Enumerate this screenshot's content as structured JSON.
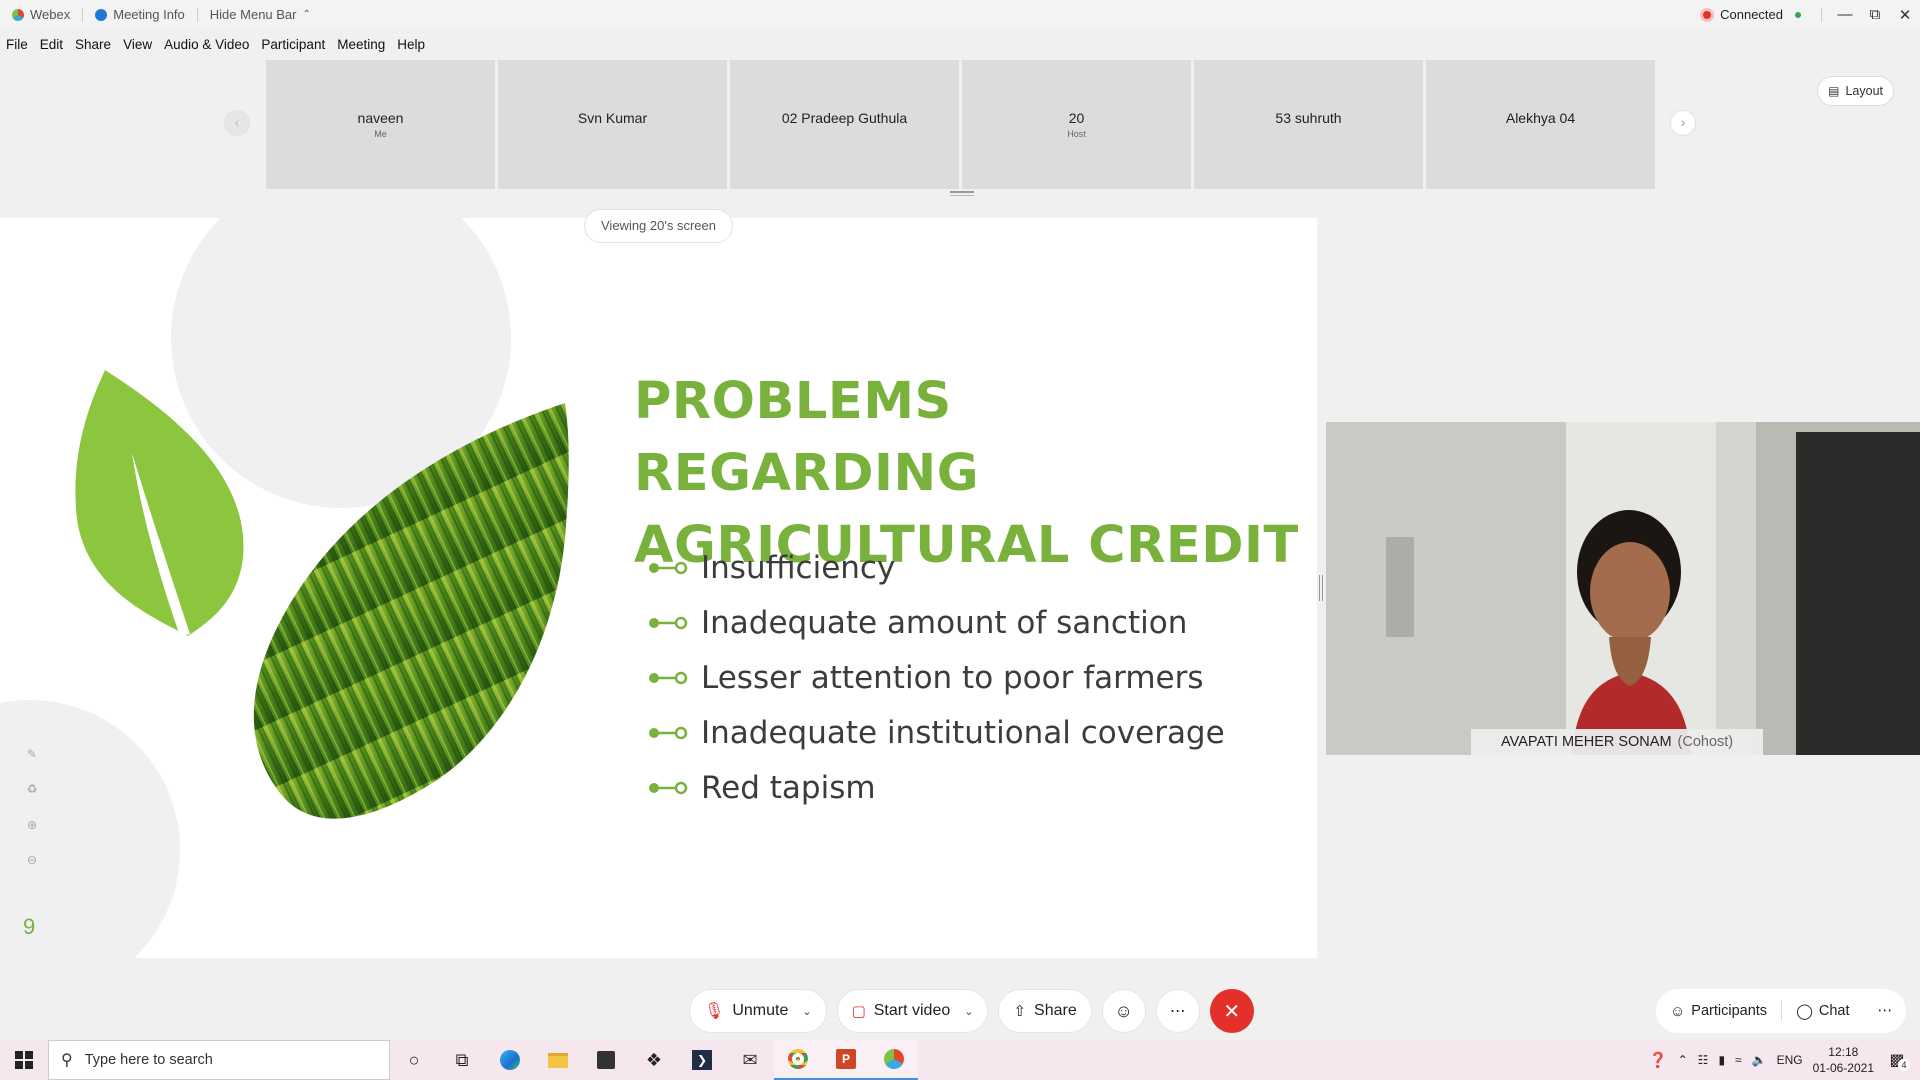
{
  "titlebar": {
    "app_name": "Webex",
    "meeting_info": "Meeting Info",
    "hide_menu": "Hide Menu Bar",
    "status": "Connected"
  },
  "menu": [
    "File",
    "Edit",
    "Share",
    "View",
    "Audio & Video",
    "Participant",
    "Meeting",
    "Help"
  ],
  "participants": [
    {
      "name": "naveen",
      "role": "Me"
    },
    {
      "name": "Svn Kumar",
      "role": ""
    },
    {
      "name": "02 Pradeep Guthula",
      "role": ""
    },
    {
      "name": "20",
      "role": "Host"
    },
    {
      "name": "53 suhruth",
      "role": ""
    },
    {
      "name": "Alekhya 04",
      "role": ""
    }
  ],
  "layout_label": "Layout",
  "viewing_label": "Viewing 20's screen",
  "slide": {
    "title_line1": "PROBLEMS REGARDING",
    "title_line2": "AGRICULTURAL CREDIT",
    "bullets": [
      "Insufficiency",
      "Inadequate amount of sanction",
      "Lesser attention to poor farmers",
      "Inadequate institutional coverage",
      "Red tapism"
    ],
    "number": "9",
    "accent_color": "#78b23c"
  },
  "video": {
    "name": "AVAPATI MEHER SONAM",
    "role": "(Cohost)"
  },
  "controls": {
    "unmute": "Unmute",
    "start_video": "Start video",
    "share": "Share",
    "participants": "Participants",
    "chat": "Chat",
    "leave_color": "#e3302b"
  },
  "taskbar": {
    "search_placeholder": "Type here to search",
    "language": "ENG",
    "time": "12:18",
    "date": "01-06-2021",
    "notifications": "4"
  }
}
